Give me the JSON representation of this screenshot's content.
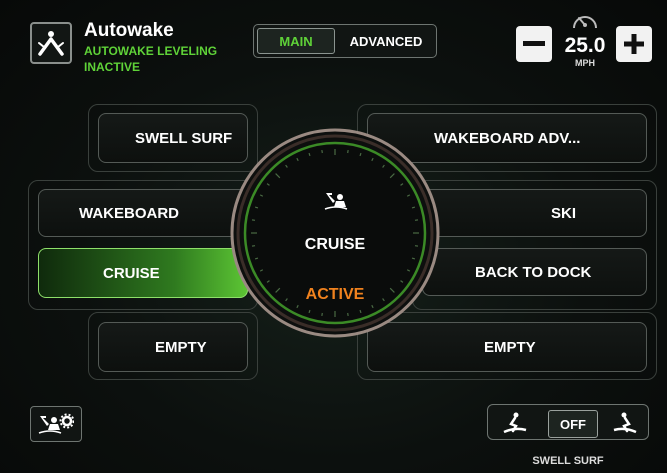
{
  "header": {
    "title": "Autowake",
    "subtitle_line1": "AUTOWAKE LEVELING",
    "subtitle_line2": "INACTIVE",
    "tabs": [
      {
        "label": "MAIN",
        "selected": true
      },
      {
        "label": "ADVANCED",
        "selected": false
      }
    ],
    "speed": {
      "value": "25.0",
      "unit": "MPH",
      "minus": "−",
      "plus": "+"
    }
  },
  "modes": {
    "swell_surf": "SWELL SURF",
    "wakeboard_adv": "WAKEBOARD ADV...",
    "wakeboard": "WAKEBOARD",
    "ski": "SKI",
    "cruise": "CRUISE",
    "back_to_dock": "BACK TO DOCK",
    "empty_left": "EMPTY",
    "empty_right": "EMPTY"
  },
  "dial": {
    "mode": "CRUISE",
    "status": "ACTIVE",
    "icon": "rider-icon"
  },
  "footer": {
    "settings_icon": "rider-settings-icon",
    "surf_toggle": "OFF",
    "surf_label": "SWELL SURF"
  },
  "colors": {
    "accent_green": "#5fd238",
    "active_orange": "#f0821e",
    "background": "#0b0d0c"
  }
}
